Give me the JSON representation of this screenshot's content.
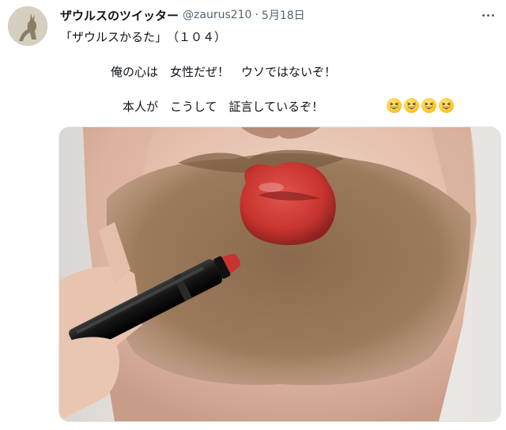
{
  "tweet": {
    "display_name": "ザウルスのツイッター",
    "handle": "@zaurus210",
    "separator": "·",
    "date": "5月18日",
    "line1": "「ザウルスかるた」　（１０４）",
    "line2": "俺の心は　女性だぜ！　ウソではないぞ！",
    "line3": "本人が　こうして　証言しているぞ！",
    "emoji": [
      "grinning-squinting-face",
      "grinning-squinting-face",
      "grinning-squinting-face",
      "grinning-squinting-face"
    ]
  },
  "icons": {
    "more": "more-horizontal-icon"
  },
  "colors": {
    "text": "#0f1419",
    "secondary": "#536471",
    "lipstick": "#c8342f",
    "border": "#e1e8ed"
  }
}
